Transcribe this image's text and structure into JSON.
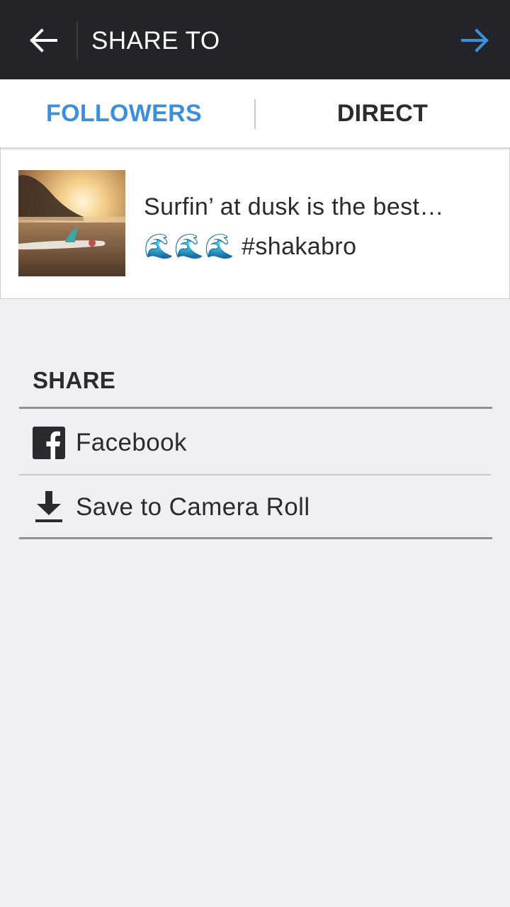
{
  "header": {
    "title": "SHARE TO",
    "back_icon": "arrow-left-icon",
    "next_icon": "arrow-right-icon",
    "accent_color": "#3d8fdb",
    "bar_color": "#232429"
  },
  "tabs": [
    {
      "label": "FOLLOWERS",
      "active": true
    },
    {
      "label": "DIRECT",
      "active": false
    }
  ],
  "post": {
    "caption_line1": "Surfin’ at dusk is the best…",
    "caption_line2": "🌊🌊🌊 #shakabro",
    "thumbnail": "beach-sunset-surfboard-photo"
  },
  "share": {
    "heading": "SHARE",
    "items": [
      {
        "label": "Facebook",
        "icon": "facebook-icon"
      },
      {
        "label": "Save to Camera Roll",
        "icon": "download-icon"
      }
    ]
  }
}
